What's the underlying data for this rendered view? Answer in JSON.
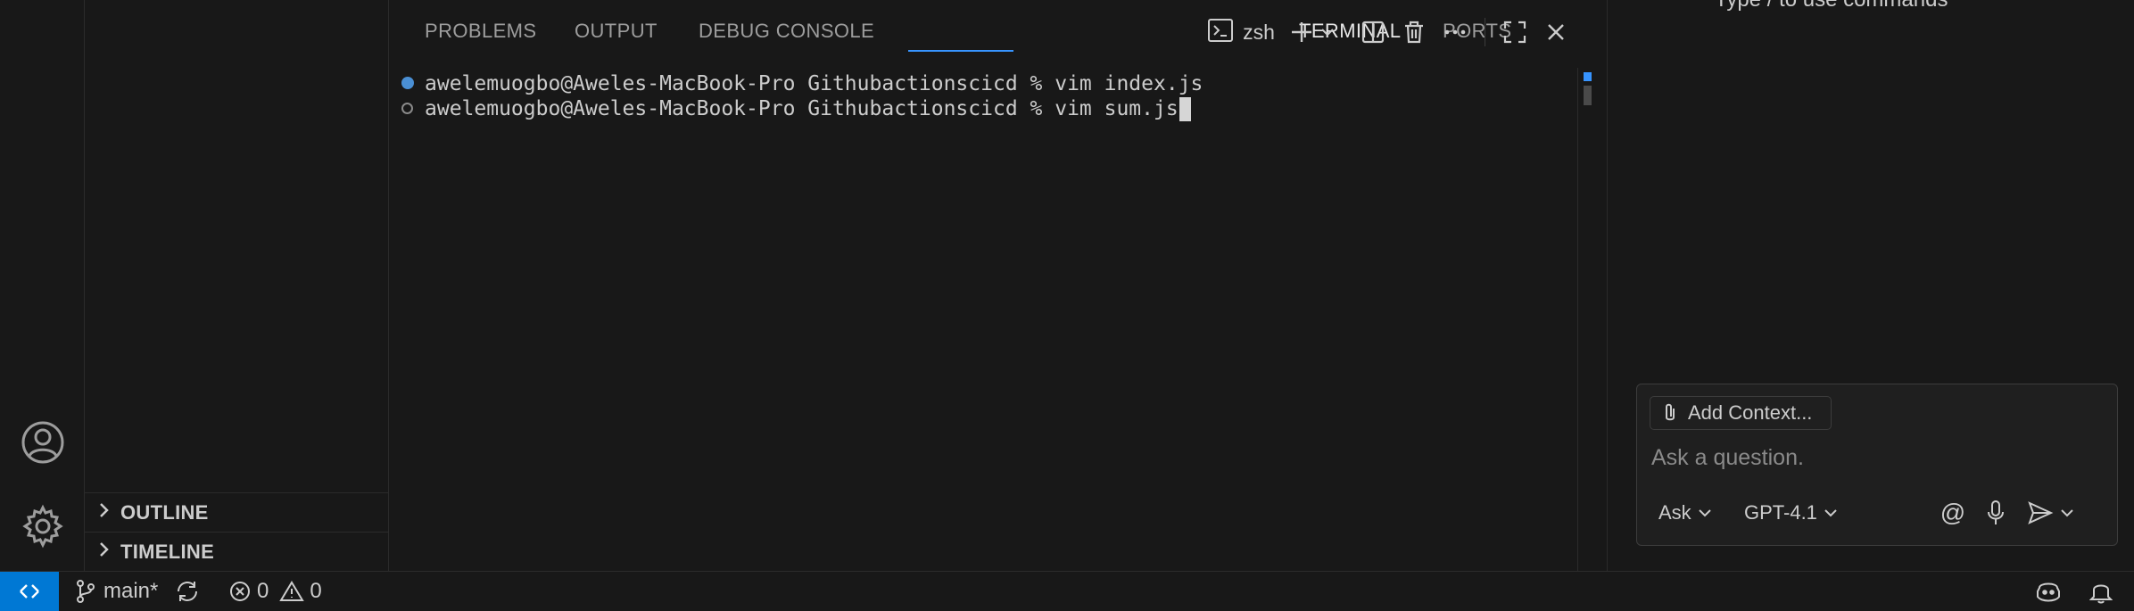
{
  "panel": {
    "tabs": [
      {
        "label": "PROBLEMS"
      },
      {
        "label": "OUTPUT"
      },
      {
        "label": "DEBUG CONSOLE"
      },
      {
        "label": "TERMINAL"
      },
      {
        "label": "PORTS"
      }
    ],
    "active_tab": "TERMINAL",
    "shell_name": "zsh"
  },
  "terminal": {
    "lines": [
      {
        "prompt": "awelemuogbo@Aweles-MacBook-Pro Githubactionscicd %",
        "command": "vim index.js",
        "marker": "completed"
      },
      {
        "prompt": "awelemuogbo@Aweles-MacBook-Pro Githubactionscicd %",
        "command": "vim sum.js",
        "marker": "current"
      }
    ]
  },
  "sidebar": {
    "sections": [
      {
        "label": "OUTLINE"
      },
      {
        "label": "TIMELINE"
      }
    ]
  },
  "chat": {
    "hint_text": "Type / to use commands",
    "add_context_label": "Add Context...",
    "input_placeholder": "Ask a question.",
    "mode_label": "Ask",
    "model_label": "GPT-4.1"
  },
  "status_bar": {
    "branch": "main*",
    "errors": "0",
    "warnings": "0"
  },
  "colors": {
    "accent": "#0078d4",
    "tab_underline": "#3794ff",
    "completed_dot": "#4a8fd4"
  }
}
